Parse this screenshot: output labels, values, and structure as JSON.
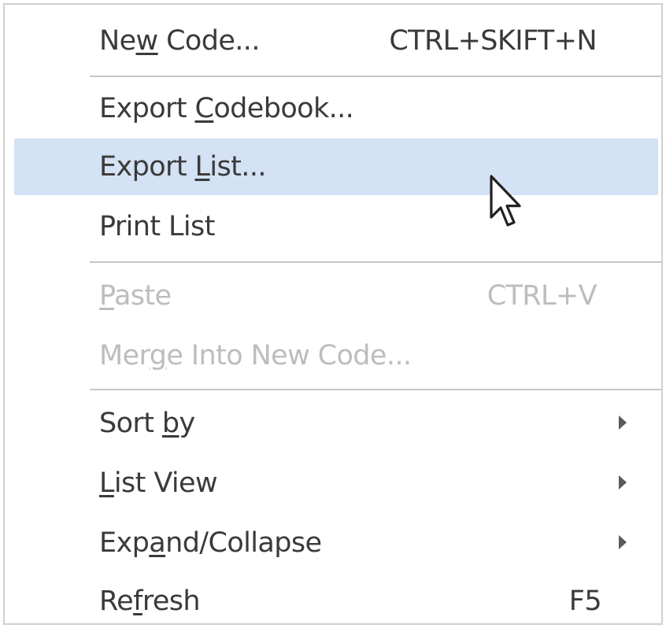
{
  "menu": {
    "items": [
      {
        "pre": "Ne",
        "u": "w",
        "post": " Code...",
        "shortcut": "CTRL+SKIFT+N"
      },
      {
        "pre": "Export ",
        "u": "C",
        "post": "odebook...",
        "shortcut": ""
      },
      {
        "pre": "Export ",
        "u": "L",
        "post": "ist...",
        "shortcut": ""
      },
      {
        "pre": "Print List",
        "u": "",
        "post": "",
        "shortcut": ""
      },
      {
        "pre": "",
        "u": "P",
        "post": "aste",
        "shortcut": "CTRL+V"
      },
      {
        "pre": "Mer",
        "u": "g",
        "post": "e Into New Code...",
        "shortcut": ""
      },
      {
        "pre": "Sort ",
        "u": "b",
        "post": "y",
        "shortcut": ""
      },
      {
        "pre": "",
        "u": "L",
        "post": "ist View",
        "shortcut": ""
      },
      {
        "pre": "Exp",
        "u": "a",
        "post": "nd/Collapse",
        "shortcut": ""
      },
      {
        "pre": "Re",
        "u": "f",
        "post": "resh",
        "shortcut": "F5"
      }
    ]
  },
  "colors": {
    "highlight": "#d3e2f4",
    "text": "#3a3a3a",
    "disabled_text": "#bdbdbd",
    "separator": "#c7c7c7"
  },
  "icons": {
    "submenu_arrow": "chevron-right-icon",
    "cursor": "mouse-pointer-icon"
  }
}
